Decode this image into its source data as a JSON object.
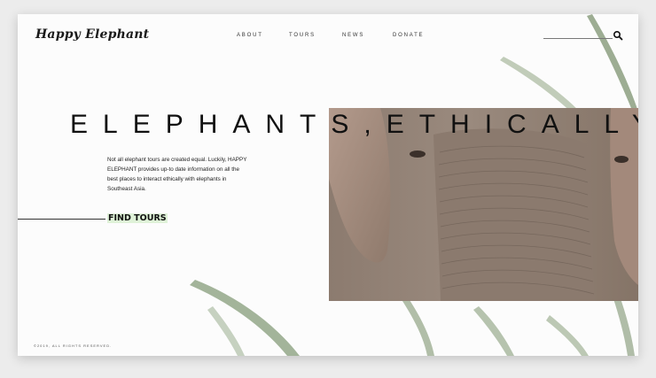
{
  "site": {
    "logo": "Happy Elephant"
  },
  "nav": {
    "items": [
      {
        "label": "ABOUT"
      },
      {
        "label": "TOURS"
      },
      {
        "label": "NEWS"
      },
      {
        "label": "DONATE"
      }
    ]
  },
  "search": {
    "icon": "search-icon"
  },
  "hero": {
    "title": "ELEPHANTS,ETHICALLY.",
    "intro": "Not all elephant tours are created equal. Luckily, HAPPY ELEPHANT provides up-to date information on all the best places to interact ethically with elephants in Southeast Asia.",
    "cta_label": "FIND TOURS"
  },
  "footer": {
    "copyright": "©2019, ALL RIGHTS RESERVED."
  },
  "colors": {
    "background": "#fcfcfc",
    "cta_highlight": "#dff2d8",
    "leaf": "#6f8a5f",
    "text": "#111111"
  }
}
